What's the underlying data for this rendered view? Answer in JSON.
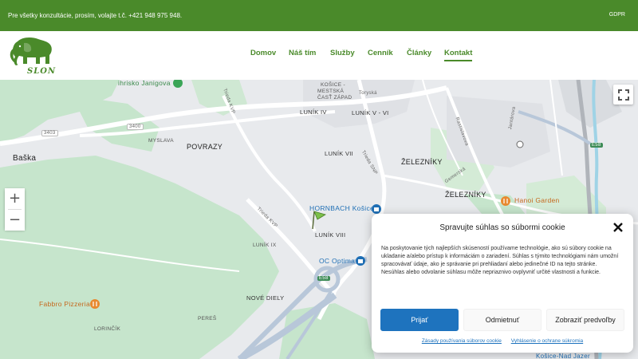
{
  "topbar": {
    "contact_text": "Pre všetky konzultácie, prosím, volajte t.č. +421 948 975 948.",
    "gdpr_link": "GDPR"
  },
  "header": {
    "logo_text": "SLON",
    "nav": [
      {
        "label": "Domov",
        "active": false
      },
      {
        "label": "Náš tím",
        "active": false
      },
      {
        "label": "Služby",
        "active": false
      },
      {
        "label": "Cenník",
        "active": false
      },
      {
        "label": "Články",
        "active": false
      },
      {
        "label": "Kontakt",
        "active": true
      }
    ]
  },
  "map": {
    "labels": {
      "ihrisko": "ihrisko Janigova",
      "myslava": "MYSLAVA",
      "povrazy": "POVRAZY",
      "baska": "Baška",
      "lunik_iv": "LUNÍK IV",
      "lunik_v_vi": "LUNÍK V - VI",
      "lunik_vii": "LUNÍK VII",
      "lunik_viii": "LUNÍK VIII",
      "lunik_ix": "LUNÍK IX",
      "zeleznik_1": "ŽELEZNÍKY",
      "zeleznik_2": "ŽELEZNÍKY",
      "kosice_zapad_1": "KOŠICE -",
      "kosice_zapad_2": "MESTSKÁ",
      "kosice_zapad_3": "ČASŤ ZÁPAD",
      "torysk": "Toryská",
      "trieda_kvp_1": "Trieda KVP",
      "trieda_kvp_2": "Trieda KVP",
      "trieda_snp": "Trieda SNP",
      "gemerska": "Gemerská",
      "rastislavova": "Rastislavova",
      "jantarova": "Jantárova",
      "hornbach": "HORNBACH Košice",
      "oc_optima": "OC Optima",
      "hanoi": "Hanoi Garden",
      "fabbro": "Fabbro Pizzeria",
      "nove_diely": "NOVÉ DIELY",
      "peres": "PEREŠ",
      "lorincik": "LORINČÍK",
      "kosice_nad_jazerom": "Košice-Nad Jazer",
      "road_3403": "3403",
      "road_3400": "3400",
      "road_e58_1": "E58",
      "road_e58_2": "E58"
    },
    "zoom_in": "+",
    "zoom_out": "−"
  },
  "cookie": {
    "title": "Spravujte súhlas so súbormi cookie",
    "body": "Na poskytovanie tých najlepších skúseností používame technológie, ako sú súbory cookie na ukladanie a/alebo prístup k informáciám o zariadení. Súhlas s týmito technológiami nám umožní spracovávať údaje, ako je správanie pri prehliadaní alebo jedinečné ID na tejto stránke. Nesúhlas alebo odvolanie súhlasu môže nepriaznivo ovplyvniť určité vlastnosti a funkcie.",
    "accept": "Prijať",
    "deny": "Odmietnuť",
    "prefs": "Zobraziť predvoľby",
    "link_cookie_policy": "Zásady používania súborov cookie",
    "link_privacy": "Vyhlásenie o ochrane súkromia"
  },
  "colors": {
    "brand_green": "#4a8a2a",
    "accept_blue": "#1e73be"
  }
}
